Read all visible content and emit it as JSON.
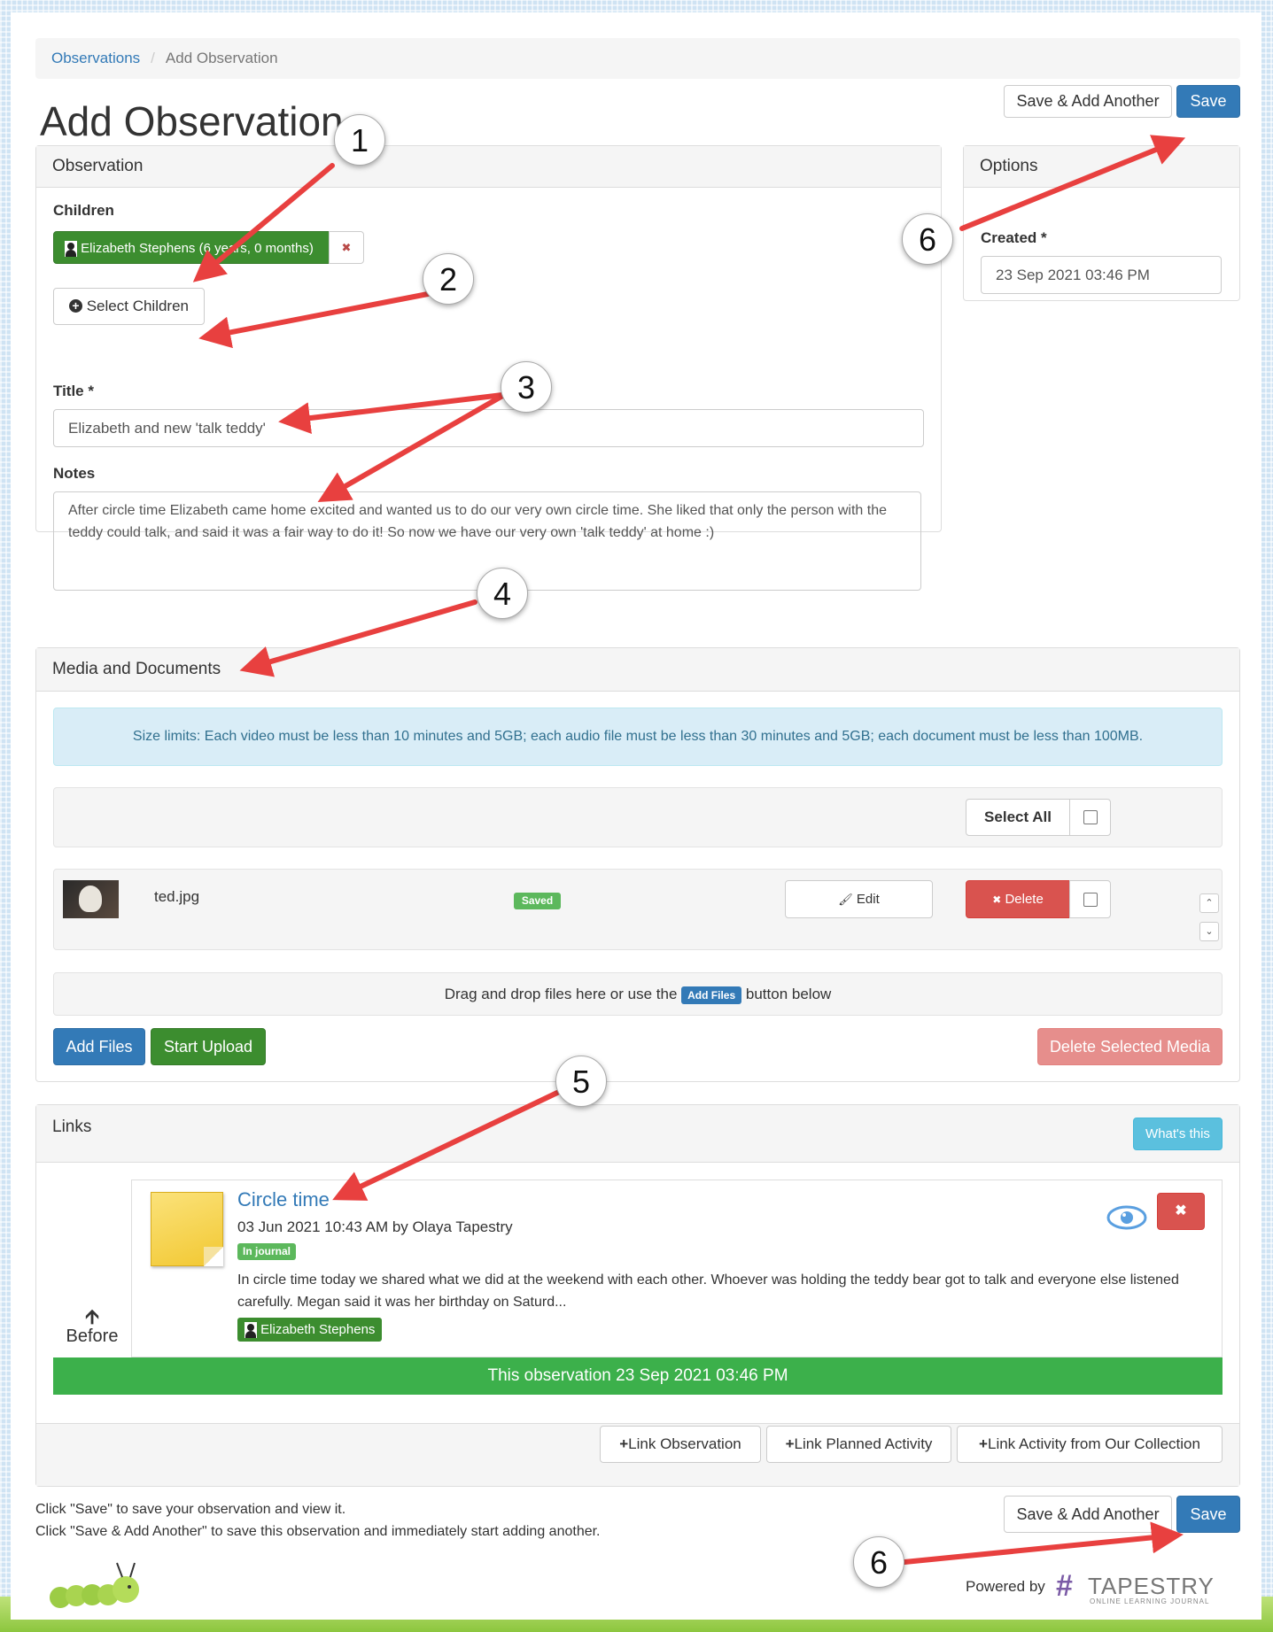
{
  "breadcrumb": {
    "link": "Observations",
    "current": "Add Observation"
  },
  "page_title": "Add Observation",
  "header_actions": {
    "save_add_another": "Save & Add Another",
    "save": "Save"
  },
  "observation_panel": {
    "heading": "Observation",
    "children_label": "Children",
    "child_chip": "Elizabeth Stephens (6 years, 0 months)",
    "remove_symbol": "✖",
    "select_children": "Select Children",
    "title_label": "Title *",
    "title_value": "Elizabeth and new 'talk teddy'",
    "notes_label": "Notes",
    "notes_value": "After circle time Elizabeth came home excited and wanted us to do our very own circle time. She liked that only the person with the teddy could talk, and said it was a fair way to do it! So now we have our very own 'talk teddy' at home :)"
  },
  "options_panel": {
    "heading": "Options",
    "created_label": "Created *",
    "created_value": "23 Sep 2021 03:46 PM"
  },
  "media_panel": {
    "heading": "Media and Documents",
    "size_limits": "Size limits: Each video must be less than 10 minutes and 5GB; each audio file must be less than 30 minutes and 5GB; each document must be less than 100MB.",
    "select_all": "Select All",
    "file": {
      "name": "ted.jpg",
      "status": "Saved",
      "edit": "Edit",
      "delete": "Delete"
    },
    "drop_text_before": "Drag and drop files here or use the",
    "drop_badge": "Add Files",
    "drop_text_after": "button below",
    "add_files": "Add Files",
    "start_upload": "Start Upload",
    "delete_selected": "Delete Selected Media"
  },
  "links_panel": {
    "heading": "Links",
    "whats_this": "What's this",
    "before_label": "Before",
    "link_title": "Circle time",
    "link_meta": "03 Jun 2021 10:43 AM by Olaya Tapestry",
    "journal_badge": "In journal",
    "link_excerpt": "In circle time today we shared what we did at the weekend with each other. Whoever was holding the teddy bear got to talk and everyone else listened carefully. Megan said it was her birthday on Saturd...",
    "child_tag": "Elizabeth Stephens",
    "this_observation": "This observation 23 Sep 2021 03:46 PM",
    "link_observation": "Link Observation",
    "link_planned": "Link Planned Activity",
    "link_collection": "Link Activity from Our Collection"
  },
  "footer": {
    "help_line1": "Click \"Save\" to save your observation and view it.",
    "help_line2": "Click \"Save & Add Another\" to save this observation and immediately start adding another.",
    "save_add_another": "Save & Add Another",
    "save": "Save",
    "powered_by": "Powered by",
    "brand": "TAPESTRY",
    "brand_sub": "ONLINE LEARNING JOURNAL"
  },
  "callouts": [
    "1",
    "2",
    "3",
    "4",
    "5",
    "6",
    "6"
  ],
  "colors": {
    "primary": "#337ab7",
    "success": "#3c8d2f",
    "danger": "#d9534f",
    "info": "#5bc0de",
    "callout_arrow": "#e8403f",
    "obs_bar": "#3cb04b"
  }
}
